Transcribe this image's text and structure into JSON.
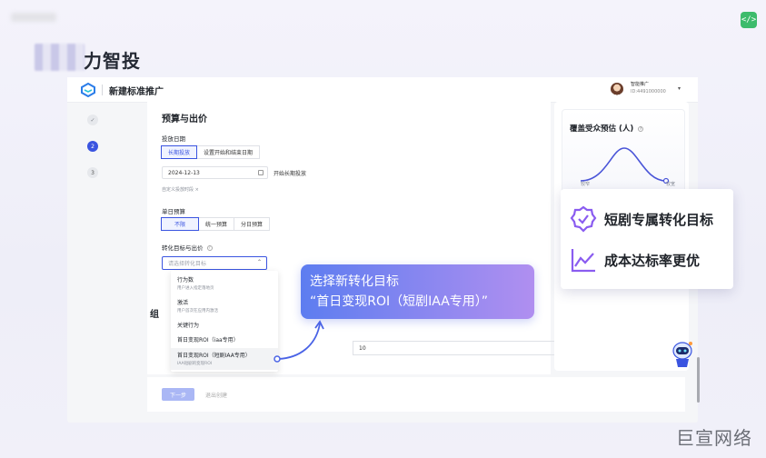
{
  "page": {
    "heading": "力智投"
  },
  "code_badge": "</>",
  "app": {
    "title": "新建标准推广",
    "account": {
      "name": "智能推广",
      "id": "ID:4491000000"
    },
    "steps": [
      "✓",
      "2",
      "3"
    ]
  },
  "budget": {
    "section_title": "预算与出价",
    "schedule_label": "投放日期",
    "schedule_options": [
      "长期投放",
      "设置开始和结束日期"
    ],
    "date_value": "2024-12-13",
    "long_term": "开始长期投放",
    "custom_hint": "自定义投放时段",
    "daily_label": "单日预算",
    "daily_options": [
      "不限",
      "统一预算",
      "分日预算"
    ],
    "goal_label": "转化目标与出价",
    "goal_placeholder": "请选择转化目标"
  },
  "dropdown": {
    "items": [
      {
        "title": "行为数",
        "sub": "用户进入指定落地页"
      },
      {
        "title": "激活",
        "sub": "用户首次在应用内激活"
      },
      {
        "title": "关键行为",
        "sub": ""
      },
      {
        "title": "首日变现ROI（iaa专用）",
        "sub": ""
      },
      {
        "title": "首日变现ROI（短剧IAA专用）",
        "sub": "IAA短剧的变现ROI"
      }
    ]
  },
  "lower": {
    "label": "组",
    "input_value": "10"
  },
  "footer": {
    "next": "下一步",
    "exit": "退出创建"
  },
  "coverage": {
    "title": "覆盖受众预估 (人)",
    "narrow": "较窄",
    "wide": "较宽"
  },
  "callout": {
    "line1": "选择新转化目标",
    "line2": "“首日变现ROI（短剧IAA专用）”"
  },
  "features": [
    {
      "icon": "badge-check-icon",
      "text": "短剧专属转化目标"
    },
    {
      "icon": "trend-chart-icon",
      "text": "成本达标率更优"
    }
  ],
  "watermark": "巨宣网络",
  "colors": {
    "accent": "#3a54e0",
    "callout_start": "#5d7df0",
    "callout_end": "#b08ff0"
  }
}
